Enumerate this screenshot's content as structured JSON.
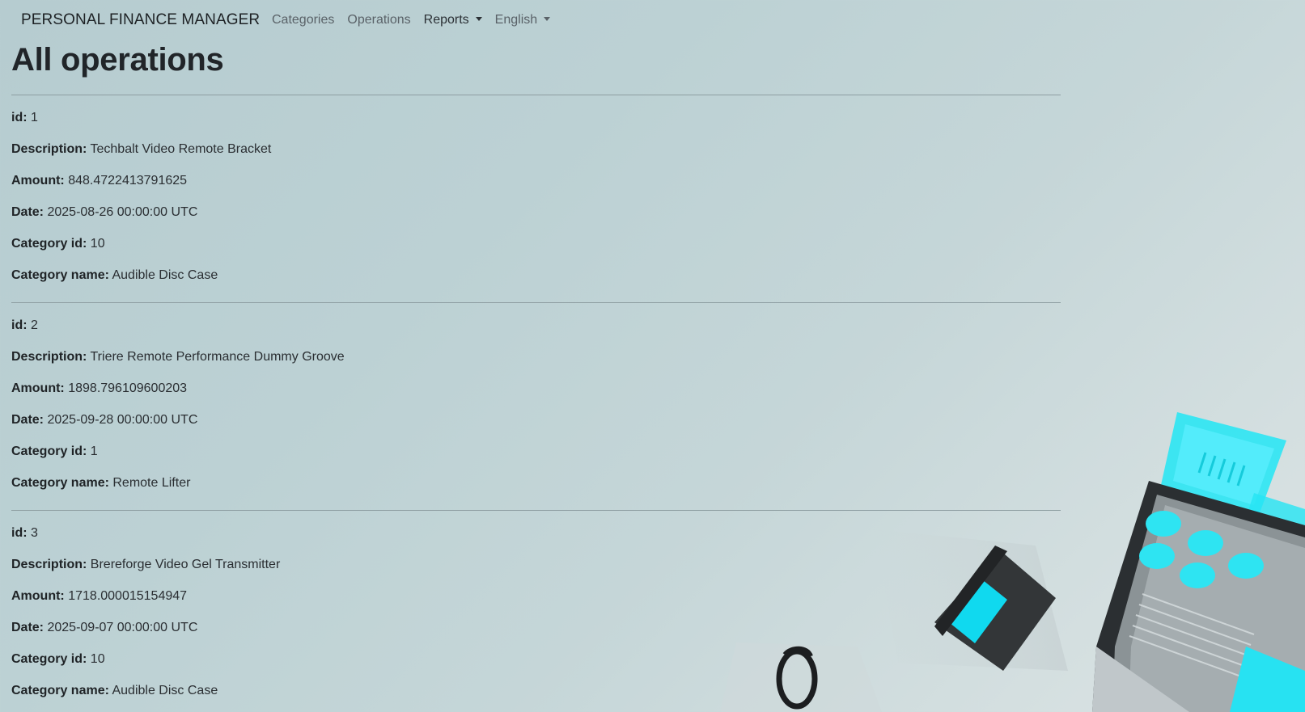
{
  "navbar": {
    "brand": "PERSONAL FINANCE MANAGER",
    "links": [
      {
        "label": "Categories"
      },
      {
        "label": "Operations"
      },
      {
        "label": "Reports"
      },
      {
        "label": "English"
      }
    ]
  },
  "page": {
    "title": "All operations"
  },
  "labels": {
    "id": "id:",
    "description": "Description:",
    "amount": "Amount:",
    "date": "Date:",
    "category_id": "Category id:",
    "category_name": "Category name:"
  },
  "operations": [
    {
      "id": "1",
      "description": "Techbalt Video Remote Bracket",
      "amount": "848.4722413791625",
      "date": "2025-08-26 00:00:00 UTC",
      "category_id": "10",
      "category_name": "Audible Disc Case"
    },
    {
      "id": "2",
      "description": "Triere Remote Performance Dummy Groove",
      "amount": "1898.796109600203",
      "date": "2025-09-28 00:00:00 UTC",
      "category_id": "1",
      "category_name": "Remote Lifter"
    },
    {
      "id": "3",
      "description": "Brereforge Video Gel Transmitter",
      "amount": "1718.000015154947",
      "date": "2025-09-07 00:00:00 UTC",
      "category_id": "10",
      "category_name": "Audible Disc Case"
    }
  ],
  "colors": {
    "background": "#bcd1d4",
    "accent_cyan": "#19e3f5",
    "text": "#212529"
  }
}
